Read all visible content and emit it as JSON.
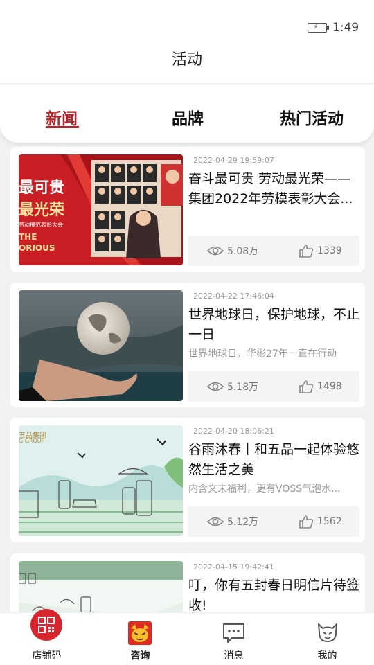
{
  "status": {
    "time": "1:49"
  },
  "page": {
    "title": "活动"
  },
  "tabs": [
    {
      "label": "新闻",
      "active": true
    },
    {
      "label": "品牌",
      "active": false
    },
    {
      "label": "热门活动",
      "active": false
    }
  ],
  "articles": [
    {
      "date": "2022-04-29 19:59:07",
      "title": "奋斗最可贵  劳动最光荣——集团2022年劳模表彰大会...",
      "subtitle": "",
      "views": "5.08万",
      "likes": "1339",
      "image_text": {
        "l1": "最可贵",
        "l2": "最光荣",
        "l3": "劳动模范表彰大会",
        "l4": "THE",
        "l5": "ORIOUS"
      }
    },
    {
      "date": "2022-04-22 17:46:04",
      "title": "世界地球日，保护地球，不止一日",
      "subtitle": "世界地球日，华彬27年一直在行动",
      "views": "5.18万",
      "likes": "1498"
    },
    {
      "date": "2022-04-20 18:06:21",
      "title": "谷雨沐春丨和五品一起体验悠然生活之美",
      "subtitle": "内含文末福利，更有VOSS气泡水...",
      "views": "5.12万",
      "likes": "1562",
      "image_text": {
        "l1": "五品集团",
        "l2": "G GROUP"
      }
    },
    {
      "date": "2022-04-15 19:42:41",
      "title": "叮，你有五封春日明信片待签收!",
      "subtitle": "",
      "views": "",
      "likes": ""
    }
  ],
  "nav": [
    {
      "label": "店铺码",
      "icon": "qr-code-icon"
    },
    {
      "label": "咨询",
      "icon": "mascot-icon"
    },
    {
      "label": "消息",
      "icon": "message-icon"
    },
    {
      "label": "我的",
      "icon": "profile-icon"
    }
  ],
  "colors": {
    "accent": "#b3262b",
    "background": "#f2f2f2"
  }
}
